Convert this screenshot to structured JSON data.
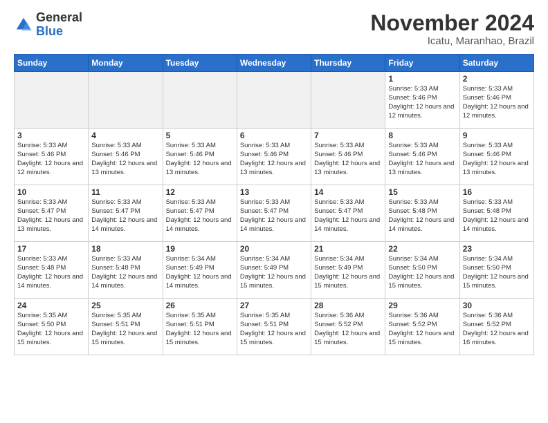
{
  "header": {
    "logo_line1": "General",
    "logo_line2": "Blue",
    "month_title": "November 2024",
    "location": "Icatu, Maranhao, Brazil"
  },
  "weekdays": [
    "Sunday",
    "Monday",
    "Tuesday",
    "Wednesday",
    "Thursday",
    "Friday",
    "Saturday"
  ],
  "weeks": [
    [
      {
        "day": "",
        "info": ""
      },
      {
        "day": "",
        "info": ""
      },
      {
        "day": "",
        "info": ""
      },
      {
        "day": "",
        "info": ""
      },
      {
        "day": "",
        "info": ""
      },
      {
        "day": "1",
        "info": "Sunrise: 5:33 AM\nSunset: 5:46 PM\nDaylight: 12 hours\nand 12 minutes."
      },
      {
        "day": "2",
        "info": "Sunrise: 5:33 AM\nSunset: 5:46 PM\nDaylight: 12 hours\nand 12 minutes."
      }
    ],
    [
      {
        "day": "3",
        "info": "Sunrise: 5:33 AM\nSunset: 5:46 PM\nDaylight: 12 hours\nand 12 minutes."
      },
      {
        "day": "4",
        "info": "Sunrise: 5:33 AM\nSunset: 5:46 PM\nDaylight: 12 hours\nand 13 minutes."
      },
      {
        "day": "5",
        "info": "Sunrise: 5:33 AM\nSunset: 5:46 PM\nDaylight: 12 hours\nand 13 minutes."
      },
      {
        "day": "6",
        "info": "Sunrise: 5:33 AM\nSunset: 5:46 PM\nDaylight: 12 hours\nand 13 minutes."
      },
      {
        "day": "7",
        "info": "Sunrise: 5:33 AM\nSunset: 5:46 PM\nDaylight: 12 hours\nand 13 minutes."
      },
      {
        "day": "8",
        "info": "Sunrise: 5:33 AM\nSunset: 5:46 PM\nDaylight: 12 hours\nand 13 minutes."
      },
      {
        "day": "9",
        "info": "Sunrise: 5:33 AM\nSunset: 5:46 PM\nDaylight: 12 hours\nand 13 minutes."
      }
    ],
    [
      {
        "day": "10",
        "info": "Sunrise: 5:33 AM\nSunset: 5:47 PM\nDaylight: 12 hours\nand 13 minutes."
      },
      {
        "day": "11",
        "info": "Sunrise: 5:33 AM\nSunset: 5:47 PM\nDaylight: 12 hours\nand 14 minutes."
      },
      {
        "day": "12",
        "info": "Sunrise: 5:33 AM\nSunset: 5:47 PM\nDaylight: 12 hours\nand 14 minutes."
      },
      {
        "day": "13",
        "info": "Sunrise: 5:33 AM\nSunset: 5:47 PM\nDaylight: 12 hours\nand 14 minutes."
      },
      {
        "day": "14",
        "info": "Sunrise: 5:33 AM\nSunset: 5:47 PM\nDaylight: 12 hours\nand 14 minutes."
      },
      {
        "day": "15",
        "info": "Sunrise: 5:33 AM\nSunset: 5:48 PM\nDaylight: 12 hours\nand 14 minutes."
      },
      {
        "day": "16",
        "info": "Sunrise: 5:33 AM\nSunset: 5:48 PM\nDaylight: 12 hours\nand 14 minutes."
      }
    ],
    [
      {
        "day": "17",
        "info": "Sunrise: 5:33 AM\nSunset: 5:48 PM\nDaylight: 12 hours\nand 14 minutes."
      },
      {
        "day": "18",
        "info": "Sunrise: 5:33 AM\nSunset: 5:48 PM\nDaylight: 12 hours\nand 14 minutes."
      },
      {
        "day": "19",
        "info": "Sunrise: 5:34 AM\nSunset: 5:49 PM\nDaylight: 12 hours\nand 14 minutes."
      },
      {
        "day": "20",
        "info": "Sunrise: 5:34 AM\nSunset: 5:49 PM\nDaylight: 12 hours\nand 15 minutes."
      },
      {
        "day": "21",
        "info": "Sunrise: 5:34 AM\nSunset: 5:49 PM\nDaylight: 12 hours\nand 15 minutes."
      },
      {
        "day": "22",
        "info": "Sunrise: 5:34 AM\nSunset: 5:50 PM\nDaylight: 12 hours\nand 15 minutes."
      },
      {
        "day": "23",
        "info": "Sunrise: 5:34 AM\nSunset: 5:50 PM\nDaylight: 12 hours\nand 15 minutes."
      }
    ],
    [
      {
        "day": "24",
        "info": "Sunrise: 5:35 AM\nSunset: 5:50 PM\nDaylight: 12 hours\nand 15 minutes."
      },
      {
        "day": "25",
        "info": "Sunrise: 5:35 AM\nSunset: 5:51 PM\nDaylight: 12 hours\nand 15 minutes."
      },
      {
        "day": "26",
        "info": "Sunrise: 5:35 AM\nSunset: 5:51 PM\nDaylight: 12 hours\nand 15 minutes."
      },
      {
        "day": "27",
        "info": "Sunrise: 5:35 AM\nSunset: 5:51 PM\nDaylight: 12 hours\nand 15 minutes."
      },
      {
        "day": "28",
        "info": "Sunrise: 5:36 AM\nSunset: 5:52 PM\nDaylight: 12 hours\nand 15 minutes."
      },
      {
        "day": "29",
        "info": "Sunrise: 5:36 AM\nSunset: 5:52 PM\nDaylight: 12 hours\nand 15 minutes."
      },
      {
        "day": "30",
        "info": "Sunrise: 5:36 AM\nSunset: 5:52 PM\nDaylight: 12 hours\nand 16 minutes."
      }
    ]
  ]
}
